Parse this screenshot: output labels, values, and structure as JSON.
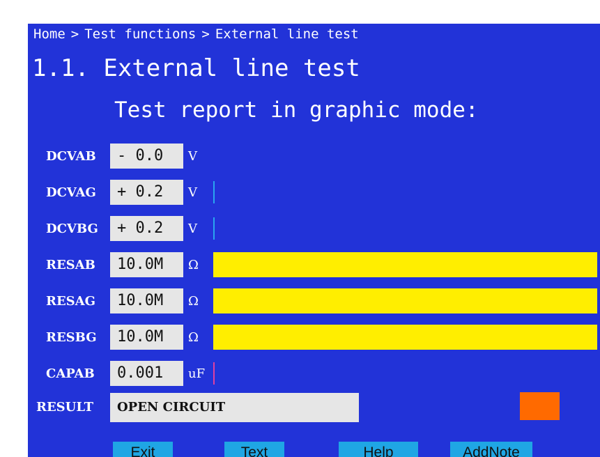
{
  "breadcrumb": [
    "Home",
    "Test functions",
    "External line test"
  ],
  "breadcrumb_separator": ">",
  "page_title": "1.1. External line test",
  "subtitle": "Test report in graphic mode:",
  "measurements": [
    {
      "label": "DCVAB",
      "value": "- 0.0",
      "unit": "V",
      "bar_color": "",
      "bar_level": 0
    },
    {
      "label": "DCVAG",
      "value": "+ 0.2",
      "unit": "V",
      "bar_color": "#2aa6f0",
      "bar_level": 0.004
    },
    {
      "label": "DCVBG",
      "value": "+ 0.2",
      "unit": "V",
      "bar_color": "#2aa6f0",
      "bar_level": 0.004
    },
    {
      "label": "RESAB",
      "value": "10.0M",
      "unit": "Ω",
      "bar_color": "#ffee00",
      "bar_level": 1
    },
    {
      "label": "RESAG",
      "value": "10.0M",
      "unit": "Ω",
      "bar_color": "#ffee00",
      "bar_level": 1
    },
    {
      "label": "RESBG",
      "value": "10.0M",
      "unit": "Ω",
      "bar_color": "#ffee00",
      "bar_level": 1
    },
    {
      "label": "CAPAB",
      "value": "0.001",
      "unit": "uF",
      "bar_color": "#e040a0",
      "bar_level": 0.004
    }
  ],
  "result": {
    "label": "RESULT",
    "value": "OPEN CIRCUIT",
    "indicator_color": "#ff6a00"
  },
  "buttons": [
    {
      "label": "Exit"
    },
    {
      "label": "Text"
    },
    {
      "label": "Help"
    },
    {
      "label": "AddNote"
    }
  ]
}
